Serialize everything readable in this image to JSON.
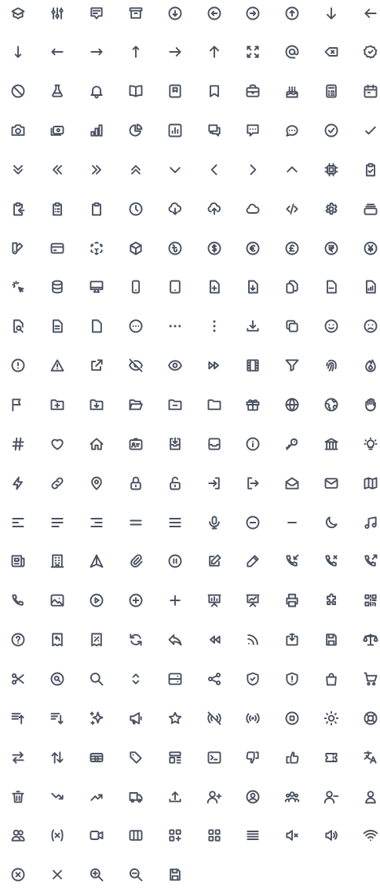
{
  "style": {
    "icon_color": "#4a5160"
  },
  "icons": [
    "academic-cap-icon",
    "adjustments-icon",
    "annotation-icon",
    "archive-icon",
    "arrow-circle-down-icon",
    "arrow-circle-left-icon",
    "arrow-circle-right-icon",
    "arrow-circle-up-icon",
    "arrow-down-icon",
    "arrow-left-icon",
    "arrow-narrow-down-icon",
    "arrow-narrow-left-icon",
    "arrow-narrow-right-icon",
    "arrow-narrow-up-icon",
    "arrow-right-icon",
    "arrow-up-icon",
    "arrows-expand-icon",
    "at-symbol-icon",
    "backspace-icon",
    "badge-check-icon",
    "ban-icon",
    "beaker-icon",
    "bell-icon",
    "book-open-icon",
    "bookmark-alt-icon",
    "bookmark-icon",
    "briefcase-icon",
    "cake-icon",
    "calculator-icon",
    "calendar-icon",
    "camera-icon",
    "cash-icon",
    "chart-bar-icon",
    "chart-pie-icon",
    "chart-square-bar-icon",
    "chat-alt-2-icon",
    "chat-alt-icon",
    "chat-icon",
    "check-circle-icon",
    "check-icon",
    "chevron-double-down-icon",
    "chevron-double-left-icon",
    "chevron-double-right-icon",
    "chevron-double-up-icon",
    "chevron-down-icon",
    "chevron-left-icon",
    "chevron-right-icon",
    "chevron-up-icon",
    "chip-icon",
    "clipboard-check-icon",
    "clipboard-copy-icon",
    "clipboard-list-icon",
    "clipboard-icon",
    "clock-icon",
    "cloud-download-icon",
    "cloud-upload-icon",
    "cloud-icon",
    "code-icon",
    "cog-icon",
    "collection-icon",
    "color-swatch-icon",
    "credit-card-icon",
    "cube-transparent-icon",
    "cube-icon",
    "currency-bangladeshi-icon",
    "currency-dollar-icon",
    "currency-euro-icon",
    "currency-pound-icon",
    "currency-rupee-icon",
    "currency-yen-icon",
    "cursor-click-icon",
    "database-icon",
    "desktop-computer-icon",
    "device-mobile-icon",
    "device-tablet-icon",
    "document-add-icon",
    "document-download-icon",
    "document-duplicate-icon",
    "document-remove-icon",
    "document-report-icon",
    "document-search-icon",
    "document-text-icon",
    "document-icon",
    "dots-circle-horizontal-icon",
    "dots-horizontal-icon",
    "dots-vertical-icon",
    "download-icon",
    "duplicate-icon",
    "emoji-happy-icon",
    "emoji-sad-icon",
    "exclamation-circle-icon",
    "exclamation-icon",
    "external-link-icon",
    "eye-off-icon",
    "eye-icon",
    "fast-forward-icon",
    "film-icon",
    "filter-icon",
    "finger-print-icon",
    "fire-icon",
    "flag-icon",
    "folder-add-icon",
    "folder-download-icon",
    "folder-open-icon",
    "folder-remove-icon",
    "folder-icon",
    "gift-icon",
    "globe-alt-icon",
    "globe-icon",
    "hand-icon",
    "hashtag-icon",
    "heart-icon",
    "home-icon",
    "identification-icon",
    "inbox-in-icon",
    "inbox-icon",
    "information-circle-icon",
    "key-icon",
    "library-icon",
    "light-bulb-icon",
    "lightning-bolt-icon",
    "link-icon",
    "location-marker-icon",
    "lock-closed-icon",
    "lock-open-icon",
    "login-icon",
    "logout-icon",
    "mail-open-icon",
    "mail-icon",
    "map-icon",
    "menu-alt-1-icon",
    "menu-alt-2-icon",
    "menu-alt-3-icon",
    "menu-alt-4-icon",
    "menu-icon",
    "microphone-icon",
    "minus-circle-icon",
    "minus-icon",
    "moon-icon",
    "music-note-icon",
    "newspaper-icon",
    "office-building-icon",
    "paper-airplane-icon",
    "paper-clip-icon",
    "pause-icon",
    "pencil-alt-icon",
    "pencil-icon",
    "phone-incoming-icon",
    "phone-missed-call-icon",
    "phone-outgoing-icon",
    "phone-icon",
    "photograph-icon",
    "play-icon",
    "plus-circle-icon",
    "plus-icon",
    "presentation-chart-bar-icon",
    "presentation-chart-line-icon",
    "printer-icon",
    "puzzle-icon",
    "qrcode-icon",
    "question-mark-circle-icon",
    "receipt-refund-icon",
    "receipt-tax-icon",
    "refresh-icon",
    "reply-icon",
    "rewind-icon",
    "rss-icon",
    "save-as-icon",
    "save-icon",
    "scale-icon",
    "scissors-icon",
    "search-circle-icon",
    "search-icon",
    "selector-icon",
    "server-icon",
    "share-icon",
    "shield-check-icon",
    "shield-exclamation-icon",
    "shopping-bag-icon",
    "shopping-cart-icon",
    "sort-ascending-icon",
    "sort-descending-icon",
    "sparkles-icon",
    "speakerphone-icon",
    "star-icon",
    "status-offline-icon",
    "status-online-icon",
    "stop-icon",
    "sun-icon",
    "support-icon",
    "switch-horizontal-icon",
    "switch-vertical-icon",
    "table-icon",
    "tag-icon",
    "template-icon",
    "terminal-icon",
    "thumb-down-icon",
    "thumb-up-icon",
    "ticket-icon",
    "translate-icon",
    "trash-icon",
    "trending-down-icon",
    "trending-up-icon",
    "truck-icon",
    "upload-icon",
    "user-add-icon",
    "user-circle-icon",
    "user-group-icon",
    "user-remove-icon",
    "user-icon",
    "users-icon",
    "variable-icon",
    "video-camera-icon",
    "view-boards-icon",
    "view-grid-add-icon",
    "view-grid-icon",
    "view-list-icon",
    "volume-off-icon",
    "volume-up-icon",
    "wifi-icon",
    "x-circle-icon",
    "x-icon",
    "zoom-in-icon",
    "zoom-out-icon",
    "save-icon"
  ]
}
